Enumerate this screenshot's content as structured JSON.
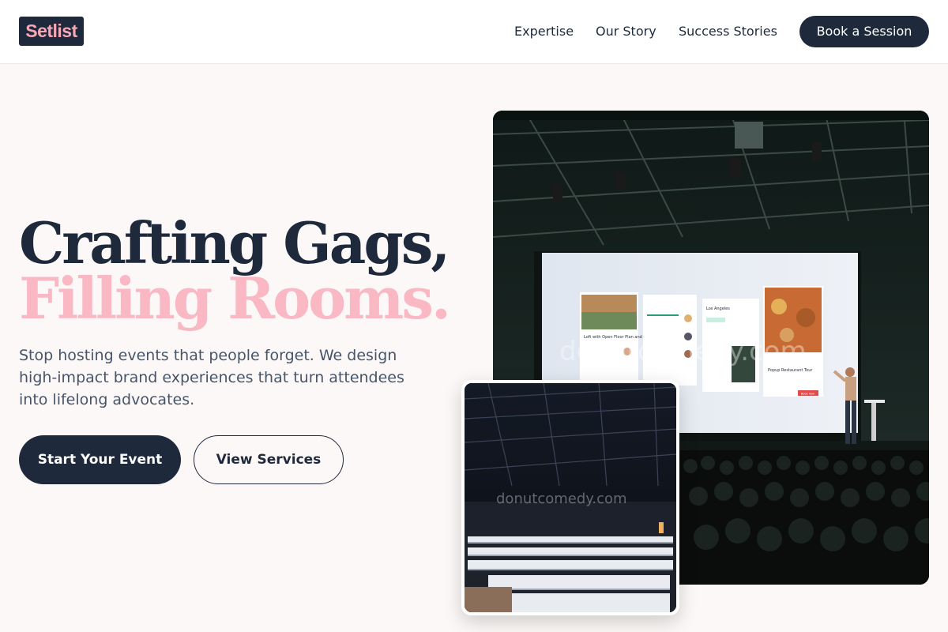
{
  "header": {
    "logo": "Setlist",
    "nav": [
      "Expertise",
      "Our Story",
      "Success Stories"
    ],
    "cta": "Book a Session"
  },
  "hero": {
    "title_line1": "Crafting Gags,",
    "title_line2": "Filling Rooms.",
    "lead": "Stop hosting events that people forget. We design high-impact brand experiences that turn attendees into lifelong advocates.",
    "primary_button": "Start Your Event",
    "secondary_button": "View Services"
  },
  "images": {
    "main_watermark": "donutcomedy.com",
    "secondary_watermark": "donutcomedy.com",
    "screen_card1_title": "Loft with Open Floor Plan and Kitchen",
    "screen_card3_title": "Los Angeles",
    "screen_card4_title": "Popup Restaurant Tour",
    "screen_book_label": "Book now"
  },
  "colors": {
    "navy": "#1e293b",
    "pink": "#f9b8c4",
    "background": "#fcf8f7"
  }
}
